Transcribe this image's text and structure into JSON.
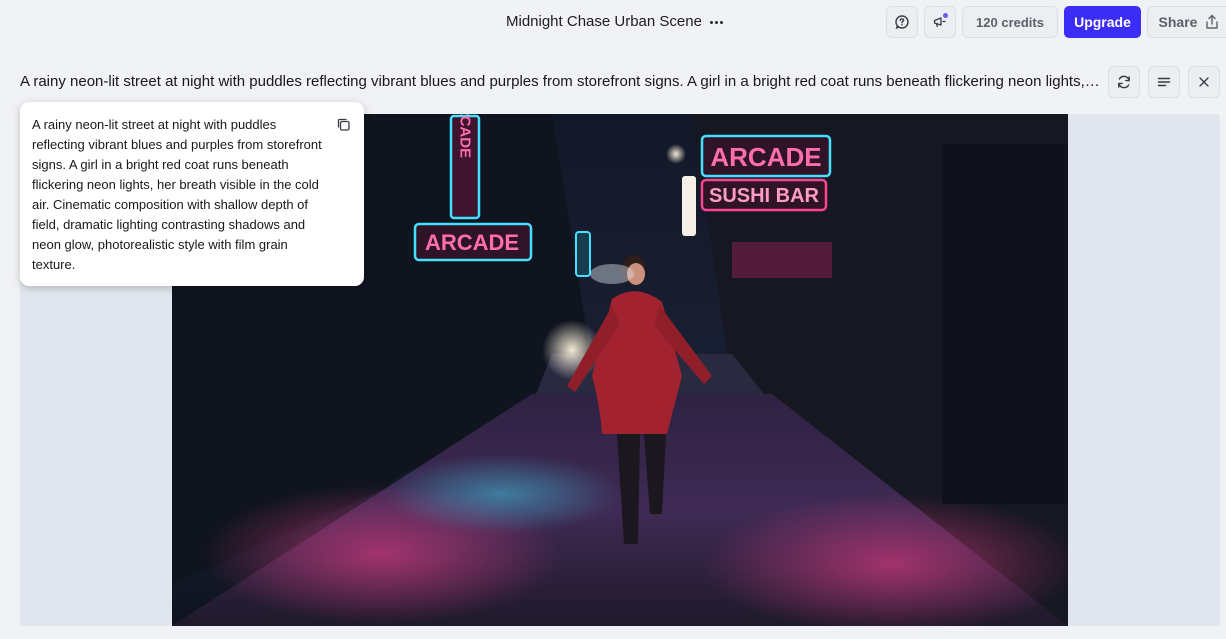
{
  "header": {
    "title": "Midnight Chase Urban Scene",
    "credits_label": "120 credits",
    "upgrade_label": "Upgrade",
    "share_label": "Share"
  },
  "prompt": {
    "truncated": "A rainy neon-lit street at night with puddles reflecting vibrant blues and purples from storefront signs. A girl in a bright red coat runs beneath flickering neon lights, her breath visible in the cold air. Cinematic composition with shallow depth of field, dramatic lighting contrasting shadows and neon glow, photorealistic style with film grain texture.",
    "full": "A rainy neon-lit street at night with puddles reflecting vibrant blues and purples from storefront signs. A girl in a bright red coat runs beneath flickering neon lights, her breath visible in the cold air. Cinematic composition with shallow depth of field, dramatic lighting contrasting shadows and neon glow, photorealistic style with film grain texture."
  },
  "image": {
    "signs": {
      "arcade_vertical": "ARCADE",
      "arcade_left": "ARCADE",
      "arcade_right": "ARCADE",
      "sushi": "SUSHI BAR"
    }
  },
  "icons": {
    "more": "more-horizontal-icon",
    "feedback": "chat-help-icon",
    "announce": "megaphone-icon",
    "share": "share-icon",
    "regenerate": "refresh-icon",
    "details": "text-lines-icon",
    "close": "close-icon",
    "copy": "copy-icon"
  },
  "colors": {
    "accent": "#3b2df5",
    "neon_cyan": "#3fe0ff",
    "neon_pink": "#ff3d8f"
  }
}
